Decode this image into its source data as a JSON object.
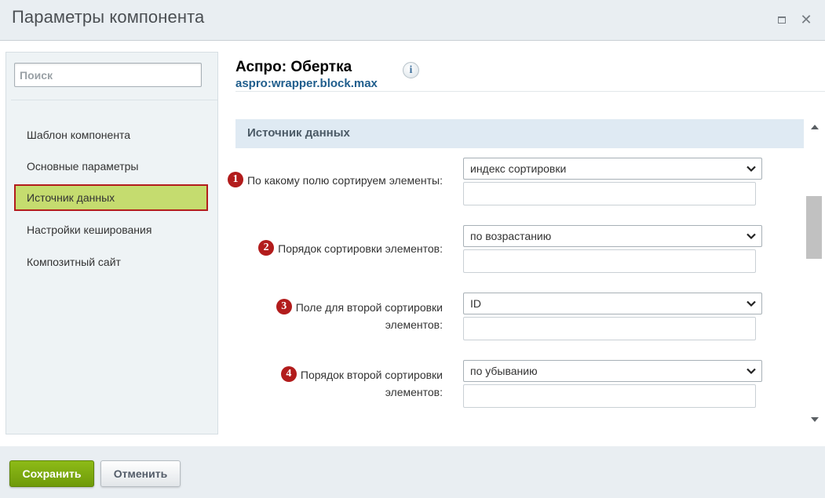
{
  "window": {
    "title": "Параметры компонента"
  },
  "sidebar": {
    "search_placeholder": "Поиск",
    "items": [
      {
        "label": "Шаблон компонента"
      },
      {
        "label": "Основные параметры"
      },
      {
        "label": "Источник данных",
        "active": true
      },
      {
        "label": "Настройки кеширования"
      },
      {
        "label": "Композитный сайт"
      }
    ]
  },
  "component": {
    "title": "Аспро: Обертка",
    "code": "aspro:wrapper.block.max",
    "info_icon": "info-icon"
  },
  "section": {
    "title": "Источник данных"
  },
  "params": [
    {
      "badge": "1",
      "label_line1": "По какому полю сортируем элементы:",
      "label_line2": "",
      "value": "индекс сортировки"
    },
    {
      "badge": "2",
      "label_line1": "Порядок сортировки элементов:",
      "label_line2": "",
      "value": "по возрастанию"
    },
    {
      "badge": "3",
      "label_line1": "Поле для второй сортировки",
      "label_line2": "элементов:",
      "value": "ID"
    },
    {
      "badge": "4",
      "label_line1": "Порядок второй сортировки",
      "label_line2": "элементов:",
      "value": "по убыванию"
    }
  ],
  "footer": {
    "save_label": "Сохранить",
    "cancel_label": "Отменить"
  },
  "colors": {
    "active_nav_bg": "#c5dc6f",
    "active_nav_border": "#b31d1d",
    "badge": "#b21c1c",
    "save_button": "#7aa60f",
    "code_link": "#1f5d8c"
  }
}
